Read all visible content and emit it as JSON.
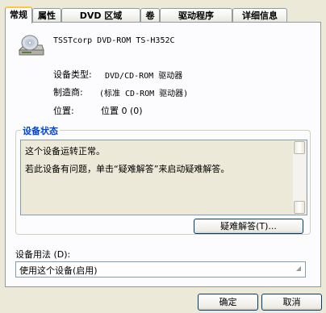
{
  "tabs": [
    "常规",
    "属性",
    "DVD 区域",
    "卷",
    "驱动程序",
    "详细信息"
  ],
  "device": {
    "icon": "dvd-drive-icon",
    "name": "TSSTcorp DVD-ROM TS-H352C",
    "type_label": "设备类型:",
    "type_value": "DVD/CD-ROM 驱动器",
    "manufacturer_label": "制造商:",
    "manufacturer_value": "(标准 CD-ROM 驱动器)",
    "location_label": "位置:",
    "location_value": "位置 0 (0)"
  },
  "status": {
    "title": "设备状态",
    "line1": "这个设备运转正常。",
    "line2": "若此设备有问题，单击“疑难解答”来启动疑难解答。",
    "troubleshoot_button": "疑难解答(T)..."
  },
  "usage": {
    "label": "设备用法 (D):",
    "selected": "使用这个设备(启用)"
  },
  "buttons": {
    "ok": "确定",
    "cancel": "取消"
  },
  "colors": {
    "group_title": "#0046D5",
    "active_tab_accent": "#FFC83C",
    "dialog_background": "#ECE9D8"
  }
}
